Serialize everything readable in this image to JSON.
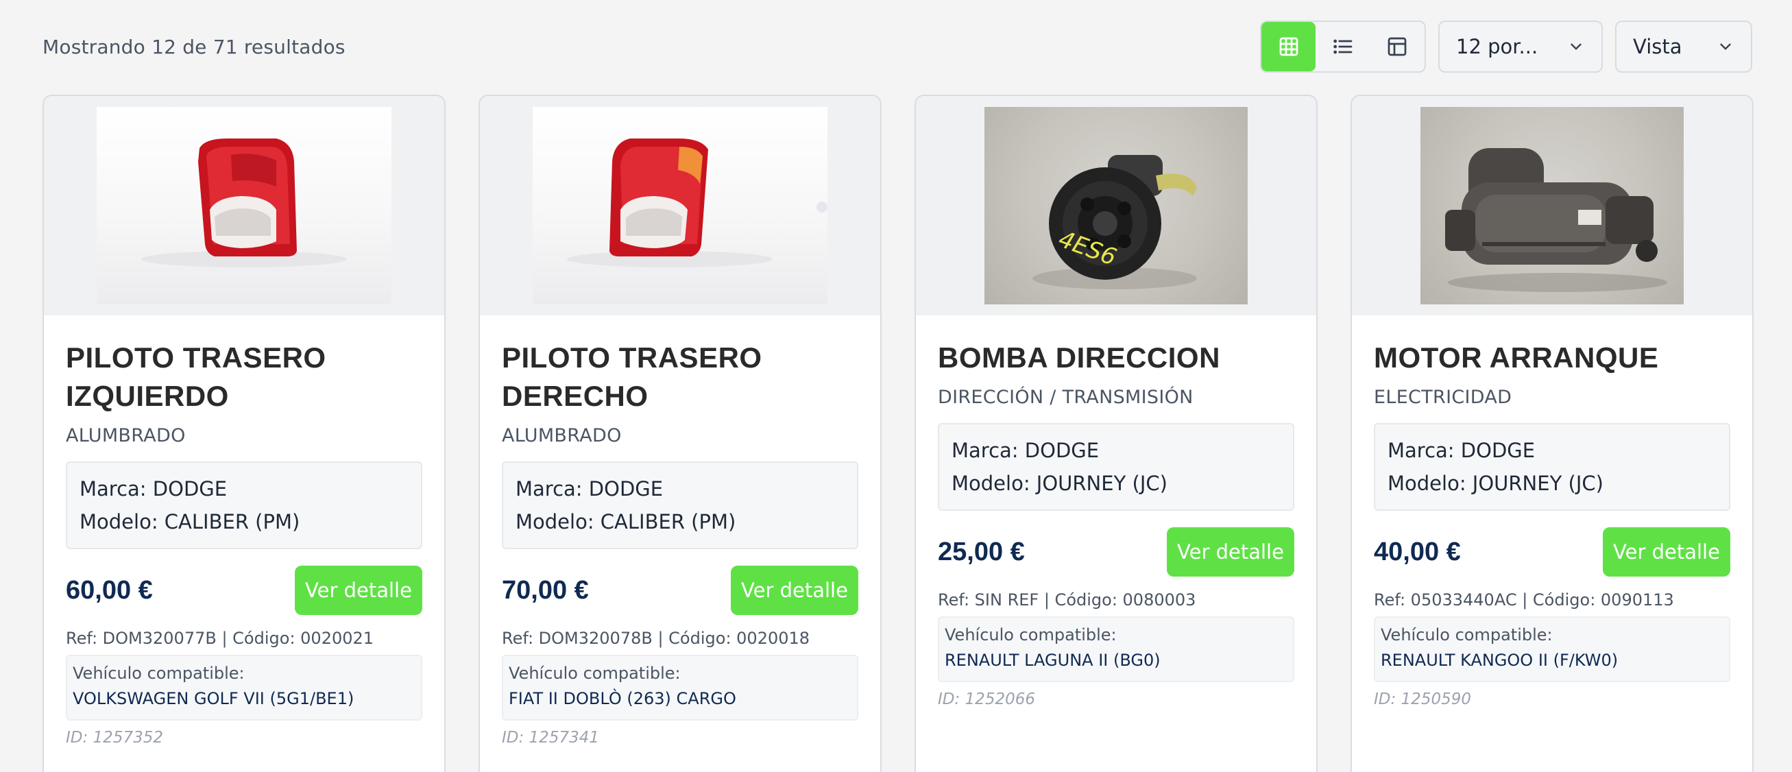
{
  "header": {
    "results_text": "Mostrando 12 de 71 resultados",
    "per_page_selected": "12 por...",
    "view_select": "Vista",
    "view_modes": [
      "grid-icon",
      "list-icon",
      "table-icon"
    ],
    "active_view": "grid"
  },
  "theme": {
    "accent": "#5fe146",
    "price_color": "#0f2a52",
    "background": "#f4f4f5"
  },
  "products": [
    {
      "title": "PILOTO TRASERO IZQUIERDO",
      "category": "ALUMBRADO",
      "brand": "Marca: DODGE",
      "model": "Modelo: CALIBER (PM)",
      "price": "60,00 €",
      "button": "Ver detalle",
      "ref": "Ref: DOM320077B | Código: 0020021",
      "compat_label": "Vehículo compatible:",
      "compat_value": "VOLKSWAGEN GOLF VII (5G1/BE1)",
      "id": "ID: 1257352",
      "image": "tail-light-photo"
    },
    {
      "title": "PILOTO TRASERO DERECHO",
      "category": "ALUMBRADO",
      "brand": "Marca: DODGE",
      "model": "Modelo: CALIBER (PM)",
      "price": "70,00 €",
      "button": "Ver detalle",
      "ref": "Ref: DOM320078B | Código: 0020018",
      "compat_label": "Vehículo compatible:",
      "compat_value": "FIAT II DOBLÒ (263) CARGO",
      "id": "ID: 1257341",
      "image": "tail-light-photo"
    },
    {
      "title": "BOMBA DIRECCION",
      "category": "DIRECCIÓN / TRANSMISIÓN",
      "brand": "Marca: DODGE",
      "model": "Modelo: JOURNEY (JC)",
      "price": "25,00 €",
      "button": "Ver detalle",
      "ref": "Ref: SIN REF | Código: 0080003",
      "compat_label": "Vehículo compatible:",
      "compat_value": "RENAULT LAGUNA II (BG0)",
      "id": "ID: 1252066",
      "image": "steering-pump-photo"
    },
    {
      "title": "MOTOR ARRANQUE",
      "category": "ELECTRICIDAD",
      "brand": "Marca: DODGE",
      "model": "Modelo: JOURNEY (JC)",
      "price": "40,00 €",
      "button": "Ver detalle",
      "ref": "Ref: 05033440AC | Código: 0090113",
      "compat_label": "Vehículo compatible:",
      "compat_value": "RENAULT KANGOO II (F/KW0)",
      "id": "ID: 1250590",
      "image": "starter-motor-photo"
    }
  ]
}
